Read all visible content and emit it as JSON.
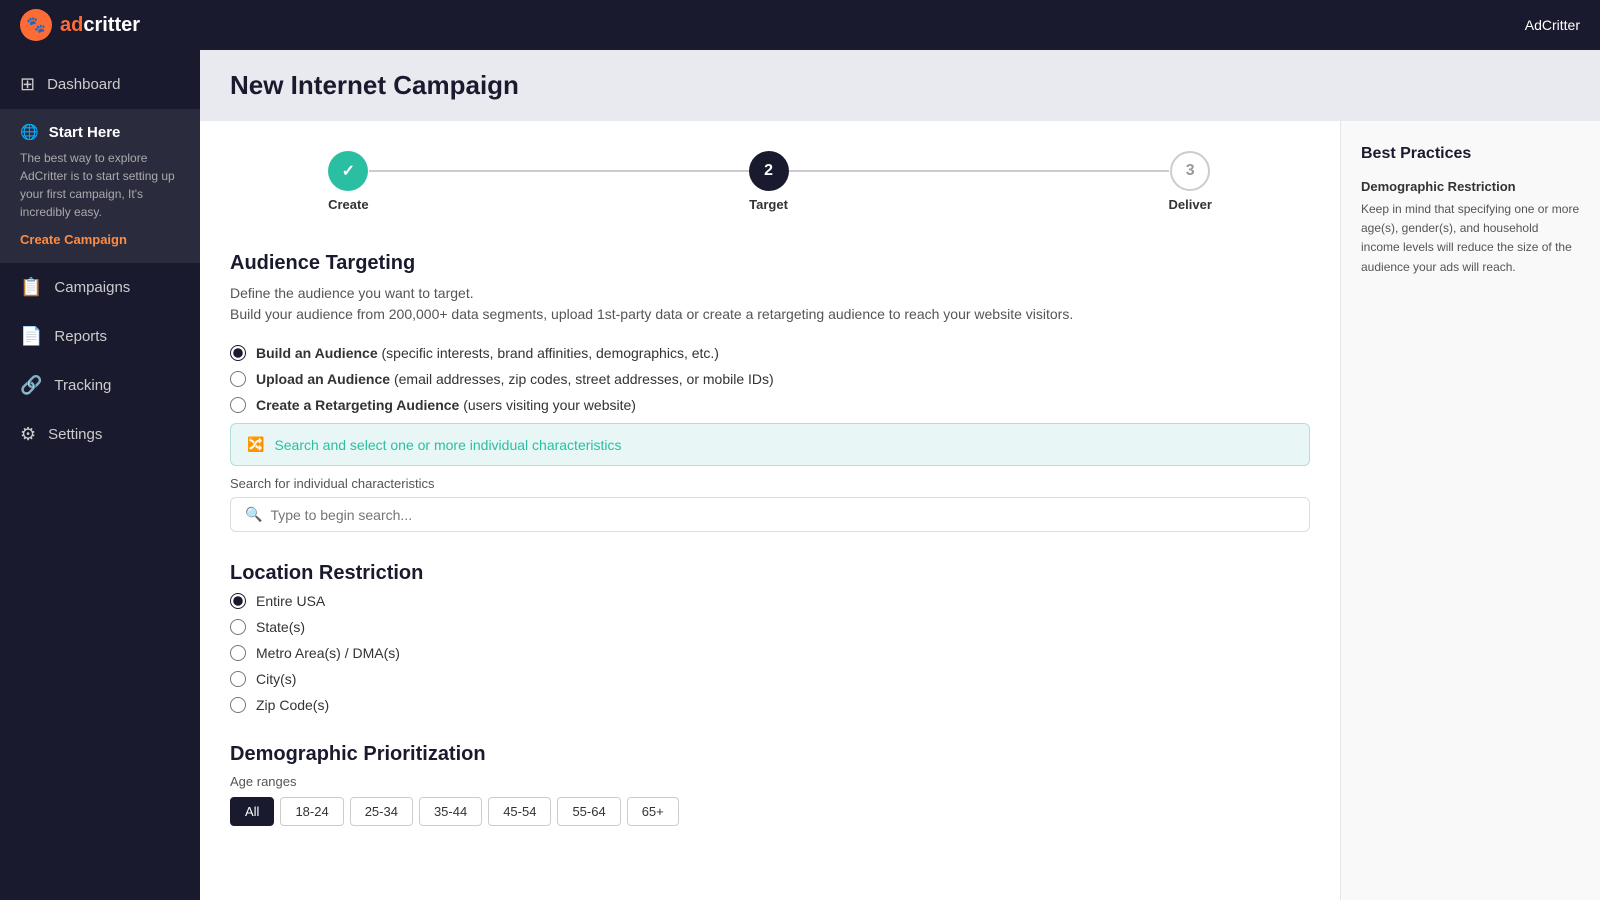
{
  "topNav": {
    "logoText1": "ad",
    "logoText2": "critter",
    "userName": "AdCritter"
  },
  "sidebar": {
    "items": [
      {
        "id": "dashboard",
        "label": "Dashboard",
        "icon": "⊞"
      },
      {
        "id": "start-here",
        "label": "Start Here",
        "icon": "🌐",
        "desc": "The best way to explore AdCritter is to start setting up your first campaign, It's incredibly easy.",
        "createBtn": "Create Campaign"
      },
      {
        "id": "campaigns",
        "label": "Campaigns",
        "icon": "📋"
      },
      {
        "id": "reports",
        "label": "Reports",
        "icon": "📄"
      },
      {
        "id": "tracking",
        "label": "Tracking",
        "icon": "🔗"
      },
      {
        "id": "settings",
        "label": "Settings",
        "icon": "⚙"
      }
    ]
  },
  "pageHeader": {
    "title": "New Internet Campaign"
  },
  "stepper": {
    "steps": [
      {
        "id": "create",
        "label": "Create",
        "number": "✓",
        "state": "done"
      },
      {
        "id": "target",
        "label": "Target",
        "number": "2",
        "state": "active"
      },
      {
        "id": "deliver",
        "label": "Deliver",
        "number": "3",
        "state": "inactive"
      }
    ]
  },
  "audienceTargeting": {
    "title": "Audience Targeting",
    "desc1": "Define the audience you want to target.",
    "desc2": "Build your audience from 200,000+ data segments, upload 1st-party data or create a retargeting audience to reach your website visitors.",
    "options": [
      {
        "id": "build",
        "label": "Build an Audience",
        "detail": "(specific interests, brand affinities, demographics, etc.)",
        "checked": true
      },
      {
        "id": "upload",
        "label": "Upload an Audience",
        "detail": "(email addresses, zip codes, street addresses, or mobile IDs)",
        "checked": false
      },
      {
        "id": "retargeting",
        "label": "Create a Retargeting Audience",
        "detail": "(users visiting your website)",
        "checked": false
      }
    ],
    "searchCharLabel": "Search and select one or more individual characteristics",
    "searchLabel": "Search for individual characteristics",
    "searchPlaceholder": "Type to begin search..."
  },
  "locationRestriction": {
    "title": "Location Restriction",
    "options": [
      {
        "id": "usa",
        "label": "Entire USA",
        "checked": true
      },
      {
        "id": "states",
        "label": "State(s)",
        "checked": false
      },
      {
        "id": "metro",
        "label": "Metro Area(s) / DMA(s)",
        "checked": false
      },
      {
        "id": "city",
        "label": "City(s)",
        "checked": false
      },
      {
        "id": "zip",
        "label": "Zip Code(s)",
        "checked": false
      }
    ]
  },
  "demographicPrioritization": {
    "title": "Demographic Prioritization",
    "ageRangesLabel": "Age ranges",
    "ageButtons": [
      {
        "id": "all",
        "label": "All",
        "active": true
      },
      {
        "id": "18-24",
        "label": "18-24",
        "active": false
      },
      {
        "id": "25-34",
        "label": "25-34",
        "active": false
      },
      {
        "id": "35-44",
        "label": "35-44",
        "active": false
      },
      {
        "id": "45-54",
        "label": "45-54",
        "active": false
      },
      {
        "id": "55-64",
        "label": "55-64",
        "active": false
      },
      {
        "id": "65+",
        "label": "65+",
        "active": false
      }
    ]
  },
  "bestPractices": {
    "title": "Best Practices",
    "items": [
      {
        "subtitle": "Demographic Restriction",
        "desc": "Keep in mind that specifying one or more age(s), gender(s), and household income levels will reduce the size of the audience your ads will reach."
      }
    ]
  }
}
